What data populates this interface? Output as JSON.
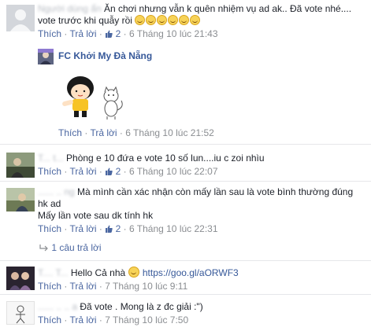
{
  "comments": [
    {
      "name": "",
      "text": "Ăn chơi nhưng vẫn k quên nhiệm vụ ad ak.. Đã vote nhé.... vote trước khi quẫy rồi",
      "emoji_count": 6,
      "like": "Thích",
      "reply": "Trả lời",
      "likes": "2",
      "time": "6 Tháng 10 lúc 21:43"
    },
    {
      "name": "FC Khởi My Đà Nẵng",
      "like": "Thích",
      "reply": "Trả lời",
      "time": "6 Tháng 10 lúc 21:52"
    },
    {
      "name": "",
      "text": "Phòng e 10 đứa e vote 10 số lun....iu c zoi nhìu",
      "like": "Thích",
      "reply": "Trả lời",
      "likes": "2",
      "time": "6 Tháng 10 lúc 22:07"
    },
    {
      "name": "",
      "text": "Mà mình cần xác nhận còn mấy lần sau là vote bình thường đúng hk ad",
      "text2": "Mấy lần vote sau dk tính hk",
      "like": "Thích",
      "reply": "Trả lời",
      "likes": "2",
      "time": "6 Tháng 10 lúc 22:31",
      "replies": "1 câu trả lời"
    },
    {
      "name": "",
      "text": "Hello Cả nhà",
      "link": "https://goo.gl/aORWF3",
      "like": "Thích",
      "reply": "Trả lời",
      "time": "7 Tháng 10 lúc 9:11"
    },
    {
      "name": "",
      "text": "Đã vote . Mong là z đc giải :\")",
      "like": "Thích",
      "reply": "Trả lời",
      "time": "7 Tháng 10 lúc 7:50"
    }
  ],
  "colors": {
    "link": "#365899",
    "meta": "#8a8d91",
    "action": "#4b67a1"
  },
  "icons": {
    "like": "thumbs-up-icon",
    "smile": "smile-emoji-icon"
  }
}
